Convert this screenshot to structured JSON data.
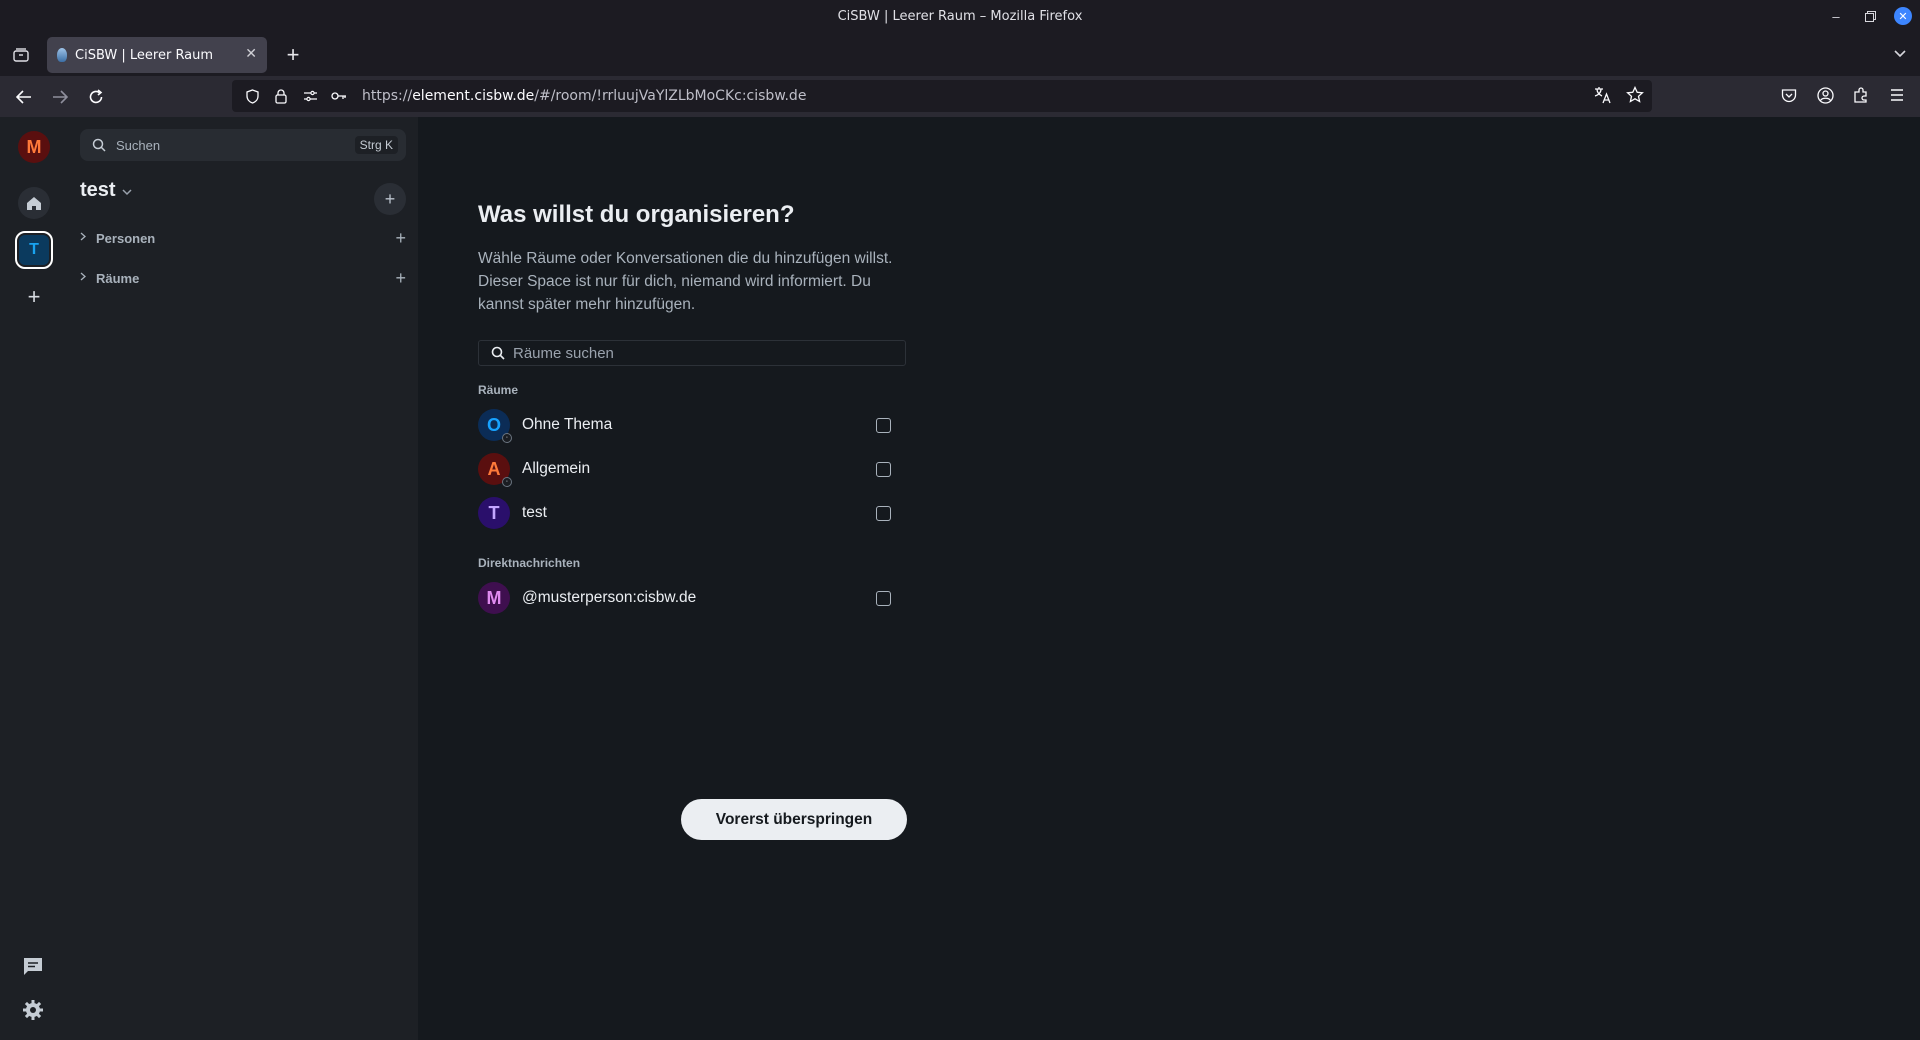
{
  "window": {
    "title": "CiSBW | Leerer Raum – Mozilla Firefox"
  },
  "tab": {
    "title": "CiSBW | Leerer Raum",
    "close": "✕"
  },
  "newtab": "+",
  "address": {
    "scheme": "https://",
    "host": "element.cisbw.de",
    "path": "/#/room/!rrluujVaYlZLbMoCKc:cisbw.de"
  },
  "sidebar": {
    "avatar_letter": "M",
    "space_letter": "T",
    "add_space": "+"
  },
  "roomlist": {
    "search_placeholder": "Suchen",
    "search_shortcut": "Strg K",
    "space_name": "test",
    "space_add": "+",
    "sections": [
      {
        "label": "Personen"
      },
      {
        "label": "Räume"
      }
    ]
  },
  "main": {
    "heading": "Was willst du organisieren?",
    "description": "Wähle Räume oder Konversationen die du hinzufügen willst. Dieser Space ist nur für dich, niemand wird informiert. Du kannst später mehr hinzufügen.",
    "search_placeholder": "Räume suchen",
    "rooms_label": "Räume",
    "rooms": [
      {
        "letter": "O",
        "name": "Ohne Thema",
        "bg": "#0b2c56",
        "fg": "#17a2ff"
      },
      {
        "letter": "A",
        "name": "Allgemein",
        "bg": "#5a0f0f",
        "fg": "#ff7a3a"
      },
      {
        "letter": "T",
        "name": "test",
        "bg": "#2a0f6b",
        "fg": "#c3a6ff"
      }
    ],
    "dm_label": "Direktnachrichten",
    "dms": [
      {
        "letter": "M",
        "name": "@musterperson:cisbw.de",
        "bg": "#3f0f4f",
        "fg": "#e08bf0"
      }
    ],
    "skip_button": "Vorerst überspringen"
  },
  "colors": {
    "accent_selected_border": "#ffffff",
    "button_bg": "#ebeef2",
    "main_bg": "#15191e",
    "sidebar_bg": "#1d2025"
  }
}
